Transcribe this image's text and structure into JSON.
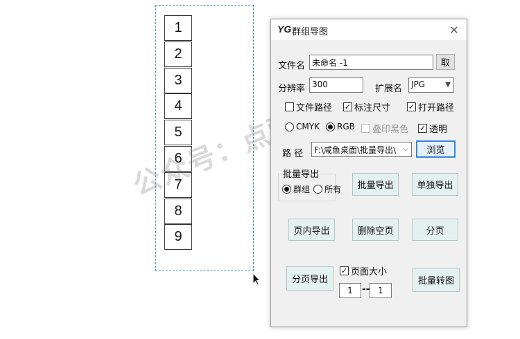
{
  "canvas": {
    "numbers": [
      "1",
      "2",
      "3",
      "4",
      "5",
      "6",
      "7",
      "8",
      "9"
    ],
    "watermark": "公众号：点酷设计"
  },
  "dialog": {
    "logo": "YG",
    "title": "群组导图",
    "filename_label": "文件名",
    "filename_value": "未命名 -1",
    "fetch_button": "取",
    "resolution_label": "分辨率",
    "resolution_value": "300",
    "extension_label": "扩展名",
    "extension_value": "JPG",
    "checks": {
      "file_path": {
        "label": "文件路径",
        "checked": false
      },
      "mark_size": {
        "label": "标注尺寸",
        "checked": true
      },
      "open_path": {
        "label": "打开路径",
        "checked": true
      },
      "overprint_black": {
        "label": "叠印黑色",
        "checked": false
      },
      "transparent": {
        "label": "透明",
        "checked": true
      },
      "page_size": {
        "label": "页面大小",
        "checked": true
      }
    },
    "color_mode": {
      "cmyk": "CMYK",
      "rgb": "RGB",
      "selected": "RGB"
    },
    "path_label": "路  径",
    "path_value": "F:\\咸鱼桌面\\批量导出\\",
    "browse_button": "浏览",
    "batch_group_title": "批量导出",
    "batch_scope": {
      "group": "群组",
      "all": "所有",
      "selected": "群组"
    },
    "buttons": {
      "batch_export": "批量导出",
      "single_export": "单独导出",
      "in_page_export": "页内导出",
      "delete_empty_pages": "删除空页",
      "paginate": "分页",
      "page_export": "分页导出",
      "batch_convert": "批量转图"
    },
    "page_from": "1",
    "page_to": "1",
    "range_separator": "--"
  }
}
